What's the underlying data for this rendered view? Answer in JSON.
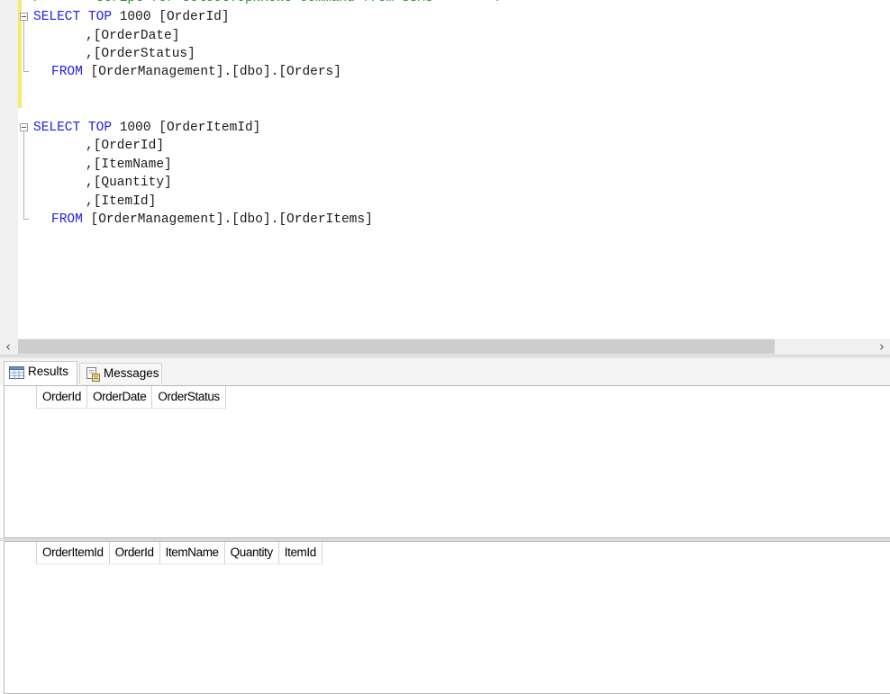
{
  "editor": {
    "comment_line": "/****** Script for SelectTopNRows command from SSMS  ******/",
    "query1": {
      "select_kw": "SELECT",
      "top_kw": "TOP",
      "top_n": "1000",
      "first_col": "[OrderId]",
      "columns": [
        ",[OrderDate]",
        ",[OrderStatus]"
      ],
      "from_kw": "FROM",
      "table": "[OrderManagement].[dbo].[Orders]"
    },
    "query2": {
      "select_kw": "SELECT",
      "top_kw": "TOP",
      "top_n": "1000",
      "first_col": "[OrderItemId]",
      "columns": [
        ",[OrderId]",
        ",[ItemName]",
        ",[Quantity]",
        ",[ItemId]"
      ],
      "from_kw": "FROM",
      "table": "[OrderManagement].[dbo].[OrderItems]"
    }
  },
  "scrollbar": {
    "left_arrow": "‹",
    "right_arrow": "›"
  },
  "tabs": [
    {
      "label": "Results",
      "icon": "grid-icon",
      "active": true
    },
    {
      "label": "Messages",
      "icon": "messages-icon",
      "active": false
    }
  ],
  "grids": [
    {
      "columns": [
        "OrderId",
        "OrderDate",
        "OrderStatus"
      ],
      "rows": []
    },
    {
      "columns": [
        "OrderItemId",
        "OrderId",
        "ItemName",
        "Quantity",
        "ItemId"
      ],
      "rows": []
    }
  ],
  "colors": {
    "keyword": "#2020e8",
    "comment": "#1a9a1a",
    "change_bar": "#f4ec6a"
  }
}
